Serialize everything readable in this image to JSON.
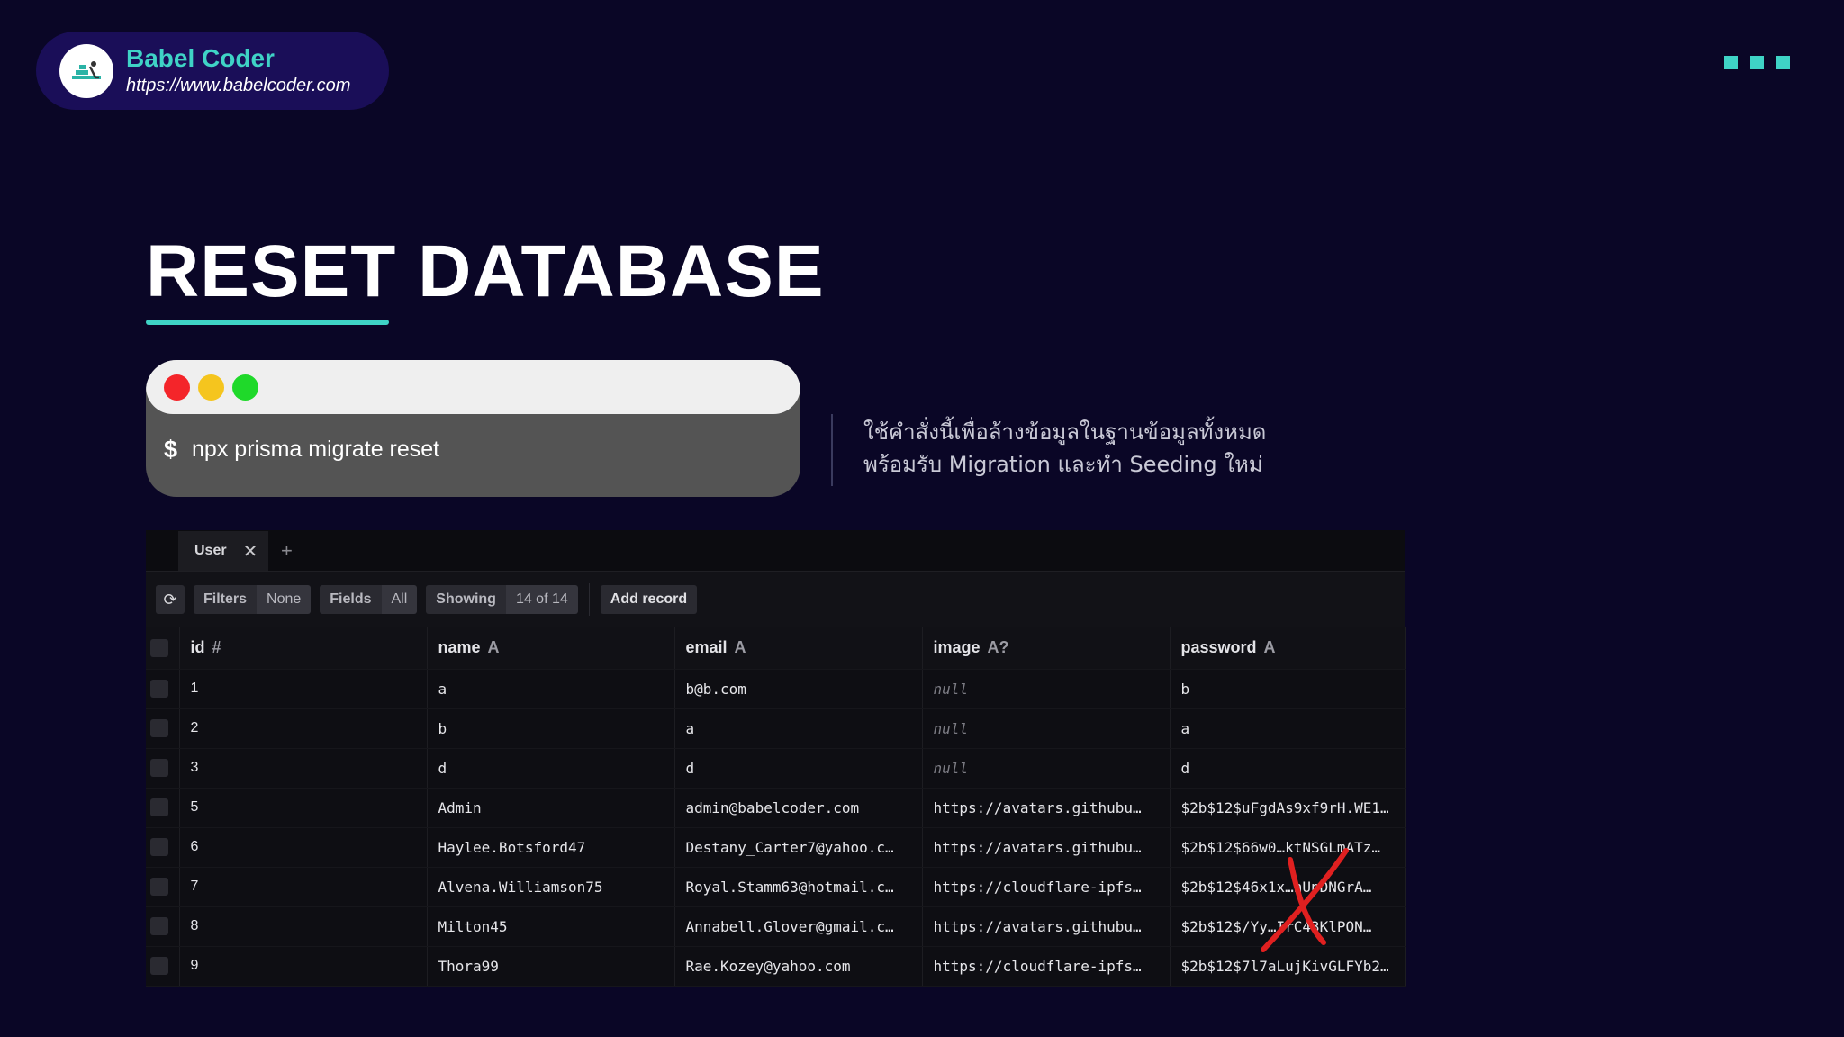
{
  "brand": {
    "name": "Babel Coder",
    "url": "https://www.babelcoder.com"
  },
  "slide": {
    "title": "RESET DATABASE",
    "description_line1": "ใช้คำสั่งนี้เพื่อล้างข้อมูลในฐานข้อมูลทั้งหมด",
    "description_line2": "พร้อมรับ Migration และทำ Seeding ใหม่"
  },
  "terminal": {
    "prompt": "$",
    "command": "npx prisma migrate reset"
  },
  "studio": {
    "tab_label": "User",
    "tab_close": "✕",
    "tab_add": "+",
    "toolbar": {
      "refresh_icon": "⟳",
      "filters_label": "Filters",
      "filters_value": "None",
      "fields_label": "Fields",
      "fields_value": "All",
      "showing_label": "Showing",
      "showing_value": "14 of 14",
      "add_record": "Add record"
    },
    "columns": [
      {
        "name": "id",
        "type": "#"
      },
      {
        "name": "name",
        "type": "A"
      },
      {
        "name": "email",
        "type": "A"
      },
      {
        "name": "image",
        "type": "A?"
      },
      {
        "name": "password",
        "type": "A"
      }
    ],
    "rows": [
      [
        "1",
        "a",
        "b@b.com",
        "null",
        "b"
      ],
      [
        "2",
        "b",
        "a",
        "null",
        "a"
      ],
      [
        "3",
        "d",
        "d",
        "null",
        "d"
      ],
      [
        "5",
        "Admin",
        "admin@babelcoder.com",
        "https://avatars.githubu…",
        "$2b$12$uFgdAs9xf9rH.WE1…"
      ],
      [
        "6",
        "Haylee.Botsford47",
        "Destany_Carter7@yahoo.c…",
        "https://avatars.githubu…",
        "$2b$12$66w0…ktNSGLmATz…"
      ],
      [
        "7",
        "Alvena.Williamson75",
        "Royal.Stamm63@hotmail.c…",
        "https://cloudflare-ipfs…",
        "$2b$12$46x1x…nUpDNGrA…"
      ],
      [
        "8",
        "Milton45",
        "Annabell.Glover@gmail.c…",
        "https://avatars.githubu…",
        "$2b$12$/Yy…IrC43KlPON…"
      ],
      [
        "9",
        "Thora99",
        "Rae.Kozey@yahoo.com",
        "https://cloudflare-ipfs…",
        "$2b$12$7l7aLujKivGLFYb2…"
      ]
    ]
  },
  "colors": {
    "accent": "#3fd3c6",
    "background": "#0a0626",
    "red_mark": "#e02020"
  }
}
